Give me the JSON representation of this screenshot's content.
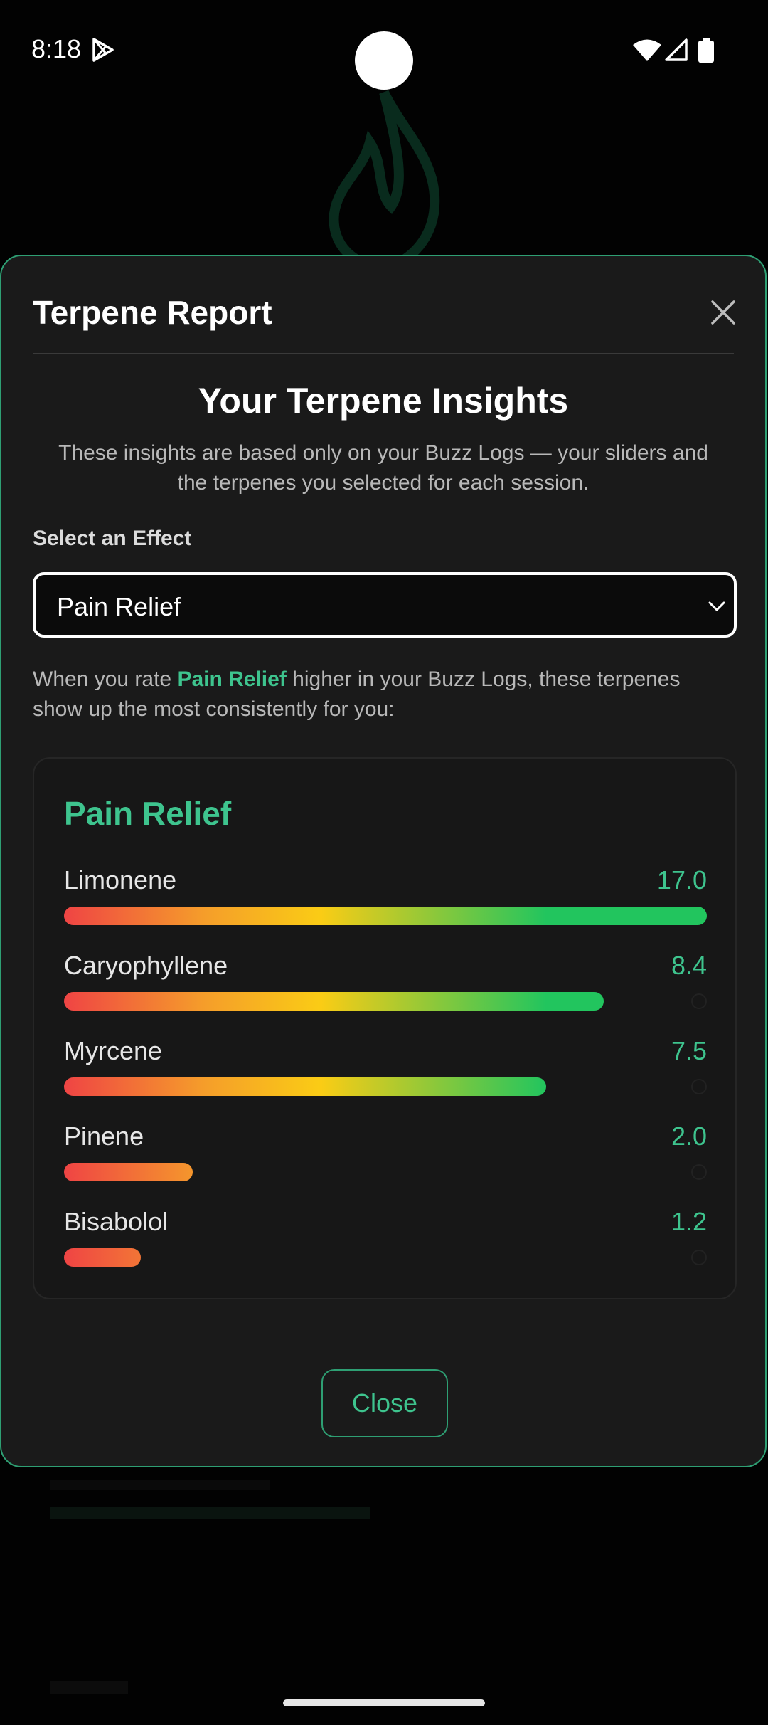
{
  "status_bar": {
    "time": "8:18"
  },
  "modal": {
    "title": "Terpene Report",
    "insights_title": "Your Terpene Insights",
    "insights_description": "These insights are based only on your Buzz Logs — your sliders and the terpenes you selected for each session.",
    "select_label": "Select an Effect",
    "selected_effect": "Pain Relief",
    "explain_prefix": "When you rate ",
    "explain_highlight": "Pain Relief",
    "explain_suffix": " higher in your Buzz Logs, these terpenes show up the most consistently for you:",
    "card_title": "Pain Relief",
    "terpenes": [
      {
        "name": "Limonene",
        "score": "17.0",
        "fill": 1.0
      },
      {
        "name": "Caryophyllene",
        "score": "8.4",
        "fill": 0.84
      },
      {
        "name": "Myrcene",
        "score": "7.5",
        "fill": 0.75
      },
      {
        "name": "Pinene",
        "score": "2.0",
        "fill": 0.2
      },
      {
        "name": "Bisabolol",
        "score": "1.2",
        "fill": 0.12
      }
    ],
    "close_label": "Close"
  },
  "colors": {
    "accent": "#3ec48e",
    "modal_border": "#2e9f73",
    "modal_bg": "#1a1a1a"
  },
  "icons": [
    "play-store-icon",
    "wifi-icon",
    "signal-icon",
    "battery-icon",
    "close-icon",
    "chevron-down-icon"
  ]
}
